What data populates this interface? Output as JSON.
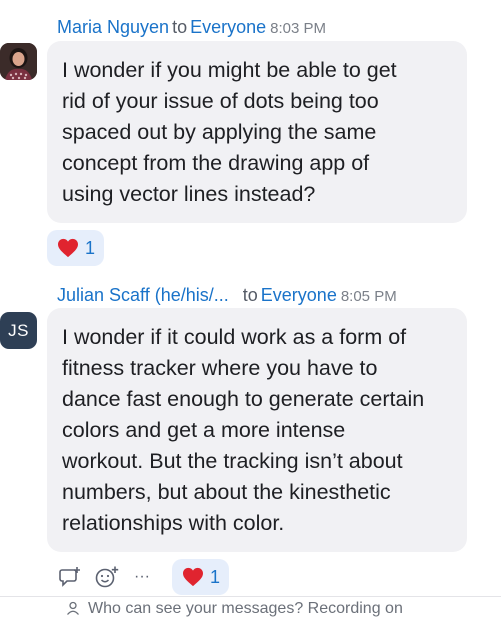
{
  "messages": [
    {
      "sender": "Maria Nguyen",
      "to": "to",
      "recipient": "Everyone",
      "time": "8:03 PM",
      "lines": [
        "I wonder if you might be able to get",
        "rid of your issue of dots being too",
        "spaced out by applying the same",
        "concept from the drawing app of",
        "using vector lines instead?"
      ],
      "reaction": {
        "icon": "heart-icon",
        "count": "1"
      }
    },
    {
      "sender": "Julian Scaff (he/his/...",
      "to": "to",
      "recipient": "Everyone",
      "time": "8:05 PM",
      "avatar_initials": "JS",
      "lines": [
        "I wonder if it could work as a form of",
        "fitness tracker where you have to",
        "dance fast enough to generate certain",
        "colors and get a more intense",
        "workout. But the tracking isn’t about",
        "numbers, but about the kinesthetic",
        "relationships with color."
      ],
      "reaction": {
        "icon": "heart-icon",
        "count": "1"
      },
      "actions": [
        "reply-icon",
        "add-reaction-icon",
        "more-icon"
      ],
      "more_label": "···"
    }
  ],
  "footer": {
    "notice": "Who can see your messages? Recording on"
  },
  "colors": {
    "accent": "#1a73c9",
    "bubble": "#f1f1f4",
    "reaction_bg": "#e6eefb",
    "heart": "#e0242f",
    "avatar_js": "#2e3f55"
  }
}
